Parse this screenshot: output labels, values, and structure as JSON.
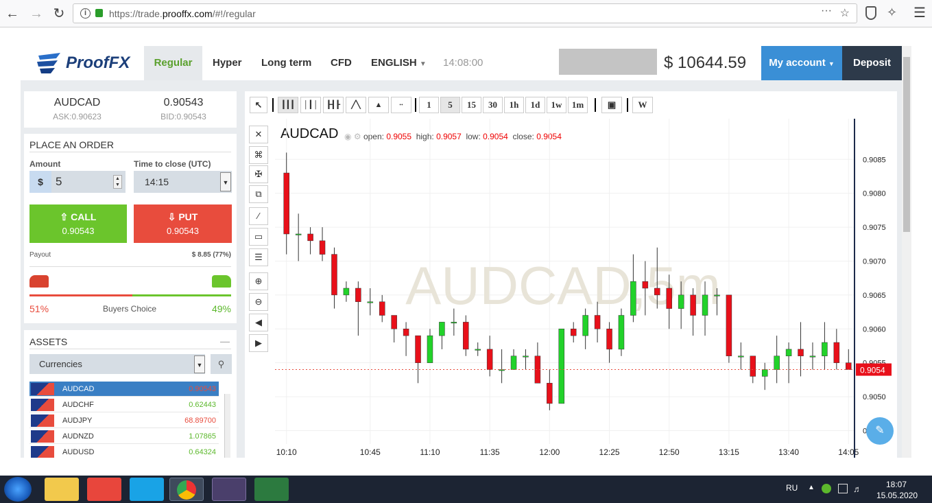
{
  "browser": {
    "url_prefix": "https://trade.",
    "url_domain": "prooffx.com",
    "url_path": "/#!/regular"
  },
  "header": {
    "logo": "ProofFX",
    "nav": [
      "Regular",
      "Hyper",
      "Long term",
      "CFD"
    ],
    "language": "ENGLISH",
    "time": "14:08:00",
    "balance": "$ 10644.59",
    "my_account": "My account",
    "deposit": "Deposit"
  },
  "quote": {
    "symbol": "AUDCAD",
    "ask": "ASK:0.90623",
    "price": "0.90543",
    "bid": "BID:0.90543"
  },
  "order": {
    "title": "PLACE AN ORDER",
    "amount_label": "Amount",
    "currency": "$",
    "amount": "5",
    "close_label": "Time to close (UTC)",
    "close_time": "14:15",
    "call_label": "CALL",
    "call_price": "0.90543",
    "put_label": "PUT",
    "put_price": "0.90543",
    "payout_label": "Payout",
    "payout_value": "$ 8.85 (77%)",
    "sell_pct": "51%",
    "buyers_label": "Buyers Choice",
    "buy_pct": "49%",
    "sell_ratio": 0.51
  },
  "assets": {
    "title": "ASSETS",
    "category": "Currencies",
    "rows": [
      {
        "name": "AUDCAD",
        "value": "0.90543",
        "color": "#e84c3d",
        "selected": true
      },
      {
        "name": "AUDCHF",
        "value": "0.62443",
        "color": "#5cb82c",
        "selected": false
      },
      {
        "name": "AUDJPY",
        "value": "68.89700",
        "color": "#e84c3d",
        "selected": false
      },
      {
        "name": "AUDNZD",
        "value": "1.07865",
        "color": "#5cb82c",
        "selected": false
      },
      {
        "name": "AUDUSD",
        "value": "0.64324",
        "color": "#5cb82c",
        "selected": false
      }
    ]
  },
  "chart": {
    "toolbar_timeframes": [
      "1",
      "5",
      "15",
      "30",
      "1h",
      "1d",
      "1w",
      "1m"
    ],
    "symbol": "AUDCAD",
    "open_label": "open:",
    "open": "0.9055",
    "high_label": "high:",
    "high": "0.9057",
    "low_label": "low:",
    "low": "0.9054",
    "close_label": "close:",
    "close": "0.9054",
    "watermark": "AUDCAD,5m",
    "current_price": "0.9054",
    "x_labels": [
      "10:10",
      "10:45",
      "11:10",
      "11:35",
      "12:00",
      "12:25",
      "12:50",
      "13:15",
      "13:40",
      "14:05"
    ],
    "y_labels": [
      "0.9085",
      "0.9080",
      "0.9075",
      "0.9070",
      "0.9065",
      "0.9060",
      "0.9055",
      "0.9050",
      "0.9045"
    ]
  },
  "chart_data": {
    "type": "candlestick",
    "x": [
      "10:10",
      "10:15",
      "10:20",
      "10:25",
      "10:30",
      "10:35",
      "10:40",
      "10:45",
      "10:50",
      "10:55",
      "11:00",
      "11:05",
      "11:10",
      "11:15",
      "11:20",
      "11:25",
      "11:30",
      "11:35",
      "11:40",
      "11:45",
      "11:50",
      "11:55",
      "12:00",
      "12:05",
      "12:10",
      "12:15",
      "12:20",
      "12:25",
      "12:30",
      "12:35",
      "12:40",
      "12:45",
      "12:50",
      "12:55",
      "13:00",
      "13:05",
      "13:10",
      "13:15",
      "13:20",
      "13:25",
      "13:30",
      "13:35",
      "13:40",
      "13:45",
      "13:50",
      "13:55",
      "14:00",
      "14:05"
    ],
    "ohlc": [
      [
        0.9083,
        0.9086,
        0.9071,
        0.9074
      ],
      [
        0.9074,
        0.9077,
        0.907,
        0.9074
      ],
      [
        0.9074,
        0.9075,
        0.9071,
        0.9073
      ],
      [
        0.9073,
        0.9075,
        0.907,
        0.9071
      ],
      [
        0.9071,
        0.9072,
        0.9063,
        0.9065
      ],
      [
        0.9065,
        0.9067,
        0.9064,
        0.9066
      ],
      [
        0.9066,
        0.9067,
        0.9059,
        0.9064
      ],
      [
        0.9064,
        0.9066,
        0.9062,
        0.9064
      ],
      [
        0.9064,
        0.9065,
        0.9061,
        0.9062
      ],
      [
        0.9062,
        0.9062,
        0.9058,
        0.906
      ],
      [
        0.906,
        0.9061,
        0.9056,
        0.9059
      ],
      [
        0.9059,
        0.9059,
        0.9052,
        0.9055
      ],
      [
        0.9055,
        0.906,
        0.9055,
        0.9059
      ],
      [
        0.9059,
        0.9061,
        0.9057,
        0.9061
      ],
      [
        0.9061,
        0.9063,
        0.9059,
        0.9061
      ],
      [
        0.9061,
        0.9062,
        0.9056,
        0.9057
      ],
      [
        0.9057,
        0.9058,
        0.9056,
        0.9057
      ],
      [
        0.9057,
        0.9059,
        0.9053,
        0.9054
      ],
      [
        0.9054,
        0.9057,
        0.9052,
        0.9054
      ],
      [
        0.9054,
        0.9057,
        0.9054,
        0.9056
      ],
      [
        0.9056,
        0.9057,
        0.9054,
        0.9056
      ],
      [
        0.9056,
        0.9058,
        0.9053,
        0.9052
      ],
      [
        0.9052,
        0.9054,
        0.9048,
        0.9049
      ],
      [
        0.9049,
        0.906,
        0.9049,
        0.906
      ],
      [
        0.906,
        0.9061,
        0.9058,
        0.9059
      ],
      [
        0.9059,
        0.9063,
        0.9057,
        0.9062
      ],
      [
        0.9062,
        0.9064,
        0.9058,
        0.906
      ],
      [
        0.906,
        0.9061,
        0.9055,
        0.9057
      ],
      [
        0.9057,
        0.9063,
        0.9056,
        0.9062
      ],
      [
        0.9062,
        0.9071,
        0.9061,
        0.9067
      ],
      [
        0.9067,
        0.907,
        0.9062,
        0.9066
      ],
      [
        0.9066,
        0.9072,
        0.9063,
        0.9065
      ],
      [
        0.9066,
        0.9068,
        0.906,
        0.9063
      ],
      [
        0.9063,
        0.9067,
        0.906,
        0.9065
      ],
      [
        0.9065,
        0.9066,
        0.9059,
        0.9062
      ],
      [
        0.9062,
        0.9067,
        0.9059,
        0.9065
      ],
      [
        0.9065,
        0.9066,
        0.9062,
        0.9065
      ],
      [
        0.9065,
        0.9065,
        0.9055,
        0.9056
      ],
      [
        0.9056,
        0.9058,
        0.9054,
        0.9056
      ],
      [
        0.9056,
        0.9056,
        0.9052,
        0.9053
      ],
      [
        0.9053,
        0.9055,
        0.9051,
        0.9054
      ],
      [
        0.9054,
        0.9059,
        0.9052,
        0.9056
      ],
      [
        0.9056,
        0.9058,
        0.9052,
        0.9057
      ],
      [
        0.9057,
        0.9061,
        0.9053,
        0.9056
      ],
      [
        0.9056,
        0.9058,
        0.9054,
        0.9056
      ],
      [
        0.9056,
        0.9061,
        0.9054,
        0.9058
      ],
      [
        0.9058,
        0.906,
        0.9054,
        0.9055
      ],
      [
        0.9055,
        0.9057,
        0.9054,
        0.9054
      ]
    ],
    "ylim": [
      0.9041,
      0.9091
    ]
  },
  "taskbar": {
    "lang": "RU",
    "time": "18:07",
    "date": "15.05.2020"
  }
}
